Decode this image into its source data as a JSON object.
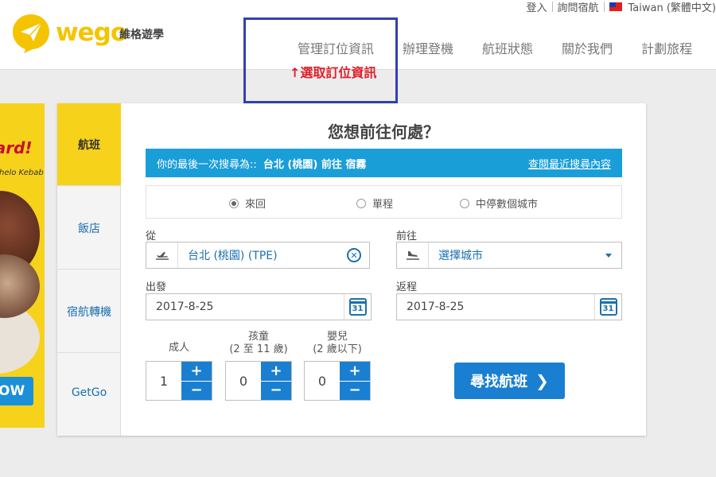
{
  "header": {
    "brand": "wego",
    "brand_sub": "維格遊學",
    "topbar": {
      "login": "登入",
      "help": "詢問宿航",
      "region": "Taiwan (繁體中文)"
    },
    "nav": [
      "管理訂位資訊",
      "辦理登機",
      "航班狀態",
      "關於我們",
      "計劃旅程"
    ],
    "annotation": "↑選取訂位資訊"
  },
  "promo": {
    "title": "oard!",
    "subtitle": "Chelo Kebab",
    "button": "OW"
  },
  "tabs": [
    "航班",
    "飯店",
    "宿航轉機",
    "GetGo"
  ],
  "form": {
    "headline": "您想前往何處？",
    "last_search": {
      "prefix": "你的最後一次搜尋為::",
      "route": "台北 (桃園) 前往 宿霧",
      "link": "查閱最近搜尋內容"
    },
    "trip_types": [
      "來回",
      "單程",
      "中停數個城市"
    ],
    "from_label": "從",
    "from_value": "台北 (桃園) (TPE)",
    "to_label": "前往",
    "to_placeholder": "選擇城市",
    "depart_label": "出發",
    "depart_value": "2017-8-25",
    "return_label": "返程",
    "return_value": "2017-8-25",
    "calendar_day": "31",
    "pax": {
      "adult_label": "成人",
      "child_label": "孩童",
      "child_note": "(2 至 11 歲)",
      "infant_label": "嬰兒",
      "infant_note": "(2 歲以下)",
      "adult_count": "1",
      "child_count": "0",
      "infant_count": "0"
    },
    "plus": "+",
    "minus": "−",
    "search_button": "尋找航班",
    "search_chevron": "❯"
  }
}
